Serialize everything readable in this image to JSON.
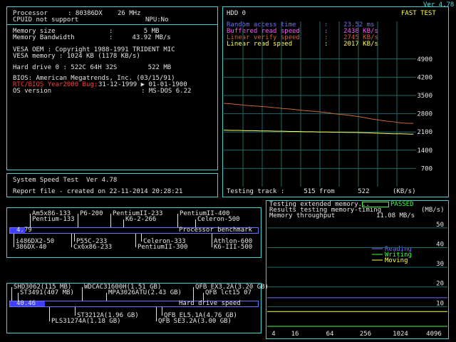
{
  "version": "Ver 4.78",
  "sysinfo": {
    "processor_label": "Processor",
    "processor_value": ": 80386DX",
    "processor_mhz": "26 MHz",
    "cpuid": "CPUID not support",
    "npu": "NPU:No",
    "mem_size_label": "Memory size",
    "mem_size_value": ":        5 MB",
    "mem_bw_label": "Memory Bandwidth",
    "mem_bw_value": ":     43.92 MB/s",
    "vesa_oem": "VESA OEM : Copyright 1988-1991 TRIDENT MIC",
    "vesa_mem": "VESA memory : 1024 KB (1178 KB/s)",
    "hdd0": "Hard drive 0 : 522C 64H 32S        522 MB",
    "bios": "BIOS: American Megatrends, Inc. (03/15/91)",
    "y2k_label": "RTC/BIOS Year2000 Bug:",
    "y2k_value": "31-12-1999 ▶ 01-01-1900",
    "os_label": "OS version",
    "os_value": ": MS-DOS 6.22"
  },
  "speedtest": {
    "title": "System Speed Test  Ver 4.78",
    "report": "Report file - created on 22-11-2014 20:28:21"
  },
  "hdd_panel": {
    "title": "HDD 0",
    "mode": "FAST TEST",
    "random_label": "Random access time",
    "random_value": ":    23.52 ms",
    "buffered_label": "Buffered read speed",
    "buffered_value": ":    2438 KB/s",
    "verify_label": "Linear verify speed",
    "verify_value": ":    2745 KB/s",
    "linear_label": "Linear read speed",
    "linear_value": ":    2017 KB/s",
    "testing_track": "Testing track :     515 from      522      (KB/s)",
    "colors": {
      "random": "#6f6fff",
      "buffered": "#ff55ff",
      "verify": "#ff3b3b",
      "linear": "#ffff55",
      "curve_orange": "#cc6633",
      "curve_yellow": "#ffff55",
      "grid": "#1d6a6a"
    }
  },
  "chart_data": [
    {
      "type": "line",
      "title": "HDD 0",
      "ylabel": "(KB/s)",
      "y_ticks": [
        700,
        1400,
        2100,
        2800,
        3500,
        4200,
        4900
      ],
      "ylim": [
        0,
        5250
      ],
      "xlim": [
        0,
        522
      ],
      "series": [
        {
          "name": "Linear verify speed",
          "color": "#cc6633",
          "x": [
            0,
            20,
            40,
            60,
            80,
            100,
            120,
            140,
            160,
            180,
            200,
            220,
            240,
            260,
            280,
            300,
            320,
            340,
            360,
            380,
            400,
            420,
            440,
            460,
            480,
            500,
            515
          ],
          "y": [
            3200,
            3180,
            3150,
            3120,
            3100,
            3080,
            3060,
            3030,
            3000,
            2980,
            2950,
            2920,
            2900,
            2870,
            2840,
            2800,
            2770,
            2740,
            2700,
            2660,
            2600,
            2560,
            2520,
            2490,
            2450,
            2430,
            2430
          ]
        },
        {
          "name": "Linear read speed",
          "color": "#ffff55",
          "x": [
            0,
            20,
            40,
            60,
            80,
            100,
            120,
            140,
            160,
            180,
            200,
            220,
            240,
            260,
            280,
            300,
            320,
            340,
            360,
            380,
            400,
            420,
            440,
            460,
            480,
            500,
            515
          ],
          "y": [
            2170,
            2160,
            2160,
            2150,
            2150,
            2140,
            2140,
            2130,
            2130,
            2120,
            2120,
            2110,
            2110,
            2100,
            2100,
            2090,
            2090,
            2080,
            2080,
            2070,
            2060,
            2050,
            2040,
            2030,
            2030,
            2020,
            2017
          ]
        }
      ]
    },
    {
      "type": "line",
      "x_ticks": [
        "4",
        "16",
        "64",
        "256",
        "1024",
        "4096"
      ],
      "y_ticks": [
        10,
        20,
        30,
        40,
        50
      ],
      "ylim": [
        0,
        55
      ],
      "series": [
        {
          "name": "Reading",
          "color": "#6f6fff",
          "values": [
            14.5,
            14.5,
            14.5,
            14.5,
            14.5,
            14.5
          ]
        },
        {
          "name": "Writing",
          "color": "#3cff3c",
          "values": [
            0,
            0,
            0,
            0,
            0,
            0
          ]
        },
        {
          "name": "Moving",
          "color": "#ffff55",
          "values": [
            7.5,
            7.5,
            7.5,
            7.5,
            7.5,
            7.5
          ]
        }
      ]
    }
  ],
  "cpu_bench": {
    "value": "4.79",
    "label": "Processor benchmark",
    "fill_fraction": 0.06,
    "top_labels": [
      "Am5x86-133",
      "P6-200",
      "PentiumII-233",
      "PentiumII-400",
      "Pentium-133",
      "K6-2-266",
      "Celeron-500"
    ],
    "bottom_labels": [
      "i486DX2-50",
      "P55C-233",
      "Celeron-333",
      "Athlon-600",
      "386DX-40",
      "Cx6x86-233",
      "PentiumII-300",
      "K6-III-500"
    ]
  },
  "hdd_bench": {
    "value": "40.46",
    "label": "Hard drive speed",
    "fill_fraction": 0.14,
    "top_labels": [
      "SHD3062(115 MB)",
      "WDCAC31600H(1.51 GB)",
      "QFB EX3.2A(3.20 GB)",
      "ST3491(407 MB)",
      "MPA3026ATU(2.43 GB)",
      "QFB lct15 07"
    ],
    "bottom_labels": [
      "ST3212A(1.96 GB)",
      "QFB EL5.1A(4.76 GB)",
      "PLS31274A(1.18 GB)",
      "QFB SE3.2A(3.00 GB)"
    ]
  },
  "memtest": {
    "line1": "Testing extended memory...",
    "line2": "Results testing memory-timing",
    "line3": "Memory throughput",
    "line3_value": "11.08 MB/s",
    "passed": "PASSED",
    "unit": "(MB/s)",
    "legend": [
      "Reading",
      "Writing",
      "Moving"
    ]
  }
}
